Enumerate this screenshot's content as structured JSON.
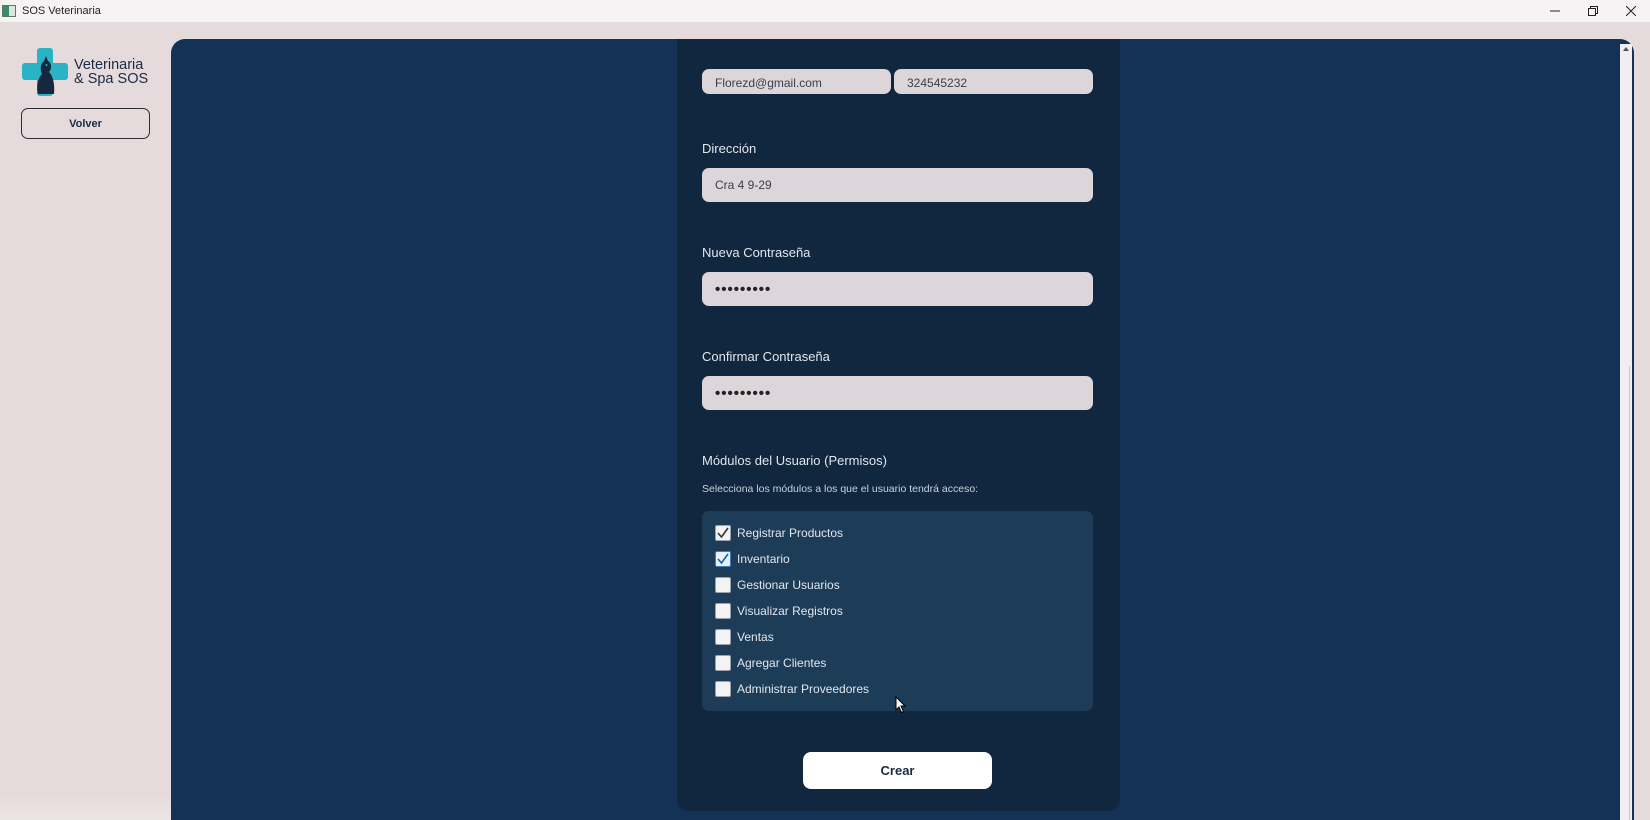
{
  "window": {
    "title": "SOS Veterinaria",
    "controls": [
      "minimize-icon",
      "restore-icon",
      "close-icon"
    ]
  },
  "sidebar": {
    "logo_line1": "Veterinaria",
    "logo_line2": "& Spa SOS",
    "back_label": "Volver"
  },
  "form": {
    "email_value": "Florezd@gmail.com",
    "phone_value": "324545232",
    "address_label": "Dirección",
    "address_value": "Cra 4 9-29",
    "new_password_label": "Nueva Contraseña",
    "new_password_value": "•••••••••",
    "confirm_password_label": "Confirmar Contraseña",
    "confirm_password_value": "•••••••••",
    "permissions_title": "Módulos del Usuario (Permisos)",
    "permissions_subtitle": "Selecciona los módulos a los que el usuario tendrá acceso:",
    "modules": [
      {
        "label": "Registrar Productos",
        "checked": true
      },
      {
        "label": "Inventario",
        "checked": true
      },
      {
        "label": "Gestionar Usuarios",
        "checked": false
      },
      {
        "label": "Visualizar Registros",
        "checked": false
      },
      {
        "label": "Ventas",
        "checked": false
      },
      {
        "label": "Agregar Clientes",
        "checked": false
      },
      {
        "label": "Administrar Proveedores",
        "checked": false
      }
    ],
    "submit_label": "Crear"
  },
  "colors": {
    "main_bg": "#143156",
    "card_bg": "#10273f",
    "sidebar_bg": "#e6dbdc",
    "accent": "#2ab3c4"
  }
}
